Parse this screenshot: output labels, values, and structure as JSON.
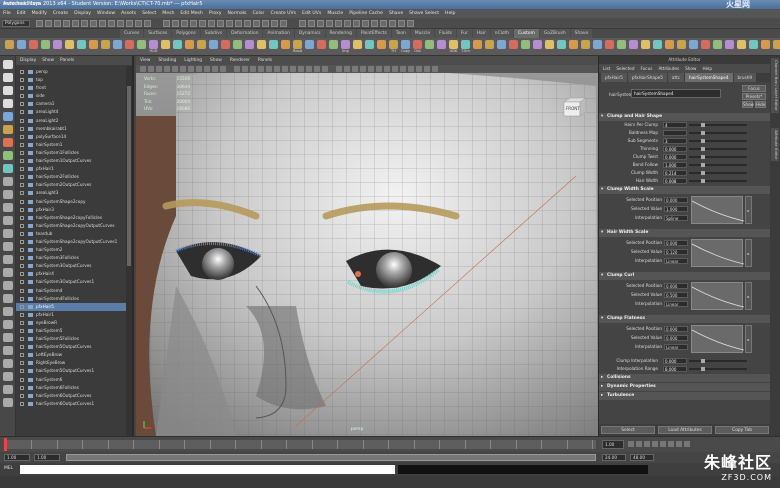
{
  "window": {
    "title": "Autodesk Maya 2013 x64 - Student Version: E:\\Works\\CT\\CT-70.mb* --- pfxHair5",
    "watermark_top_cn": "火星网",
    "watermark_top_url": "www.hxsd.com",
    "watermark_bottom_cn": "朱峰社区",
    "watermark_bottom_url": "ZF3D.COM"
  },
  "menubar": [
    "File",
    "Edit",
    "Modify",
    "Create",
    "Display",
    "Window",
    "Assets",
    "Select",
    "Mesh",
    "Edit Mesh",
    "Proxy",
    "Normals",
    "Color",
    "Create UVs",
    "Edit UVs",
    "Muscle",
    "Pipeline Cache",
    "Shave",
    "Shave Select",
    "Help"
  ],
  "statusline": {
    "mode": "Polygons"
  },
  "shelf_tabs": [
    "Curves",
    "Surfaces",
    "Polygons",
    "Subdivs",
    "Deformation",
    "Animation",
    "Dynamics",
    "Rendering",
    "PaintEffects",
    "Toon",
    "Muscle",
    "Fluids",
    "Fur",
    "Hair",
    "nCloth",
    "Custom",
    "GoZBrush",
    "Shave"
  ],
  "shelf_active_tab": "Custom",
  "shelf_icons": [
    "",
    "",
    "",
    "",
    "",
    "",
    "",
    "",
    "",
    "",
    "",
    "",
    "HUD",
    "",
    "",
    "",
    "",
    "",
    "",
    "",
    "",
    "",
    "",
    "",
    "Rood",
    "",
    "",
    "",
    "Imp",
    "",
    "",
    "",
    "TH",
    "Copy",
    "Out",
    "",
    "",
    "UDK",
    "T.Sm",
    "",
    "",
    "",
    "",
    "",
    "",
    "",
    "",
    "",
    "",
    "",
    "",
    "",
    "",
    "",
    "",
    "",
    "",
    "",
    "",
    "",
    "",
    "",
    "",
    "",
    ""
  ],
  "outliner": {
    "menu": [
      "Display",
      "Show",
      "Panels"
    ],
    "selected_index": 29,
    "items": [
      "persp",
      "top",
      "front",
      "side",
      "camera1",
      "areaLight4",
      "areaLight2",
      "membkairabt1",
      "polySurface14",
      "hairSystem1",
      "hairSystem1Follicles",
      "hairSystem1OutputCurves",
      "pfxHair1",
      "hairSystem2Follicles",
      "hairSystem2OutputCurves",
      "areaLight3",
      "hairSystemShape2copy",
      "pfxHair3",
      "hairSystemShape2copyFollicles",
      "hairSystemShape2copyOutputCurves",
      "teardub",
      "hairSystemShape2copyOutputCurves1",
      "hairSystem2",
      "hairSystem3Follicles",
      "hairSystem3OutputCurves",
      "pfxHair4",
      "hairSystem3OutputCurves1",
      "hairSystem4",
      "hairSystem4Follicles",
      "pfxHair5",
      "pfxHair1",
      "eyeBrowR",
      "hairSystem5",
      "hairSystem5Follicles",
      "hairSystem5OutputCurves",
      "LeftEyeBrow",
      "RightEyeBrow",
      "hairSystem5OutputCurves1",
      "hairSystem6",
      "hairSystem6Follicles",
      "hairSystem6OutputCurves",
      "hairSystem6OutputCurves1"
    ]
  },
  "viewport": {
    "menu": [
      "View",
      "Shading",
      "Lighting",
      "Show",
      "Renderer",
      "Panels"
    ],
    "hud": [
      {
        "key": "Verts:",
        "value": "15508"
      },
      {
        "key": "Edges:",
        "value": "30644"
      },
      {
        "key": "Faces:",
        "value": "15272"
      },
      {
        "key": "Tris:",
        "value": "30004"
      },
      {
        "key": "UVs:",
        "value": "16086"
      }
    ],
    "camera": "persp",
    "viewcube_label": "FRONT"
  },
  "attribute_editor": {
    "title": "Attribute Editor",
    "menu": [
      "List",
      "Selected",
      "Focus",
      "Attributes",
      "Show",
      "Help"
    ],
    "tabs": [
      "pfxHair5",
      "pfxHairShape5",
      "attc",
      "hairSystemShape4",
      "brush9"
    ],
    "active_tab": "hairSystemShape4",
    "node_label": "hairSystem:",
    "node_value": "hairSystemShape4",
    "buttons": {
      "focus": "Focus",
      "presets": "Presets*",
      "show": "Show",
      "hide": "Hide"
    },
    "sections": {
      "clump_shape": {
        "title": "Clump and Hair Shape",
        "fields": [
          {
            "label": "Hairs Per Clump",
            "value": "4"
          },
          {
            "label": "Baldness Map",
            "value": ""
          },
          {
            "label": "Sub Segments",
            "value": "3"
          },
          {
            "label": "Thinning",
            "value": "0.000"
          },
          {
            "label": "Clump Twist",
            "value": "0.000"
          },
          {
            "label": "Bend Follow",
            "value": "1.000"
          },
          {
            "label": "Clump Width",
            "value": "0.214"
          },
          {
            "label": "Hair Width",
            "value": "0.008"
          }
        ]
      },
      "clump_width_scale": {
        "title": "Clump Width Scale",
        "fields": [
          {
            "label": "Selected Position",
            "value": "0.000"
          },
          {
            "label": "Selected Value",
            "value": "1.000"
          },
          {
            "label": "Interpolation",
            "value": "Spline"
          }
        ]
      },
      "hair_width_scale": {
        "title": "Hair Width Scale",
        "fields": [
          {
            "label": "Selected Position",
            "value": "0.000"
          },
          {
            "label": "Selected Value",
            "value": "0.120"
          },
          {
            "label": "Interpolation",
            "value": "Linear"
          }
        ]
      },
      "clump_curl": {
        "title": "Clump Curl",
        "fields": [
          {
            "label": "Selected Position",
            "value": "0.000"
          },
          {
            "label": "Selected Value",
            "value": "0.500"
          },
          {
            "label": "Interpolation",
            "value": "Linear"
          }
        ]
      },
      "clump_flatness": {
        "title": "Clump Flatness",
        "fields": [
          {
            "label": "Selected Position",
            "value": "0.000"
          },
          {
            "label": "Selected Value",
            "value": "0.000"
          },
          {
            "label": "Interpolation",
            "value": "Linear"
          }
        ],
        "extra": [
          {
            "label": "Clump Interpolation",
            "value": "0.000"
          },
          {
            "label": "Interpolation Range",
            "value": "8.000"
          }
        ]
      },
      "collapsed": [
        "Collisions",
        "Dynamic Properties",
        "Turbulence"
      ]
    },
    "bottom_buttons": [
      "Select",
      "Load Attributes",
      "Copy Tab"
    ]
  },
  "side_tabs": [
    "Channel Box / Layer Editor",
    "Attribute Editor"
  ],
  "time_slider": {
    "ticks": [
      "1",
      "2",
      "3",
      "4",
      "5",
      "6",
      "7",
      "8",
      "9",
      "10",
      "11",
      "12",
      "13",
      "14",
      "15",
      "16",
      "17",
      "18",
      "19",
      "20",
      "21",
      "22",
      "23",
      "24"
    ],
    "current_time": "1.00"
  },
  "range_slider": {
    "start": "1.00",
    "inner_start": "1.00",
    "end_inner": "24.00",
    "end": "48.00"
  },
  "command_line": {
    "label": "MEL"
  }
}
